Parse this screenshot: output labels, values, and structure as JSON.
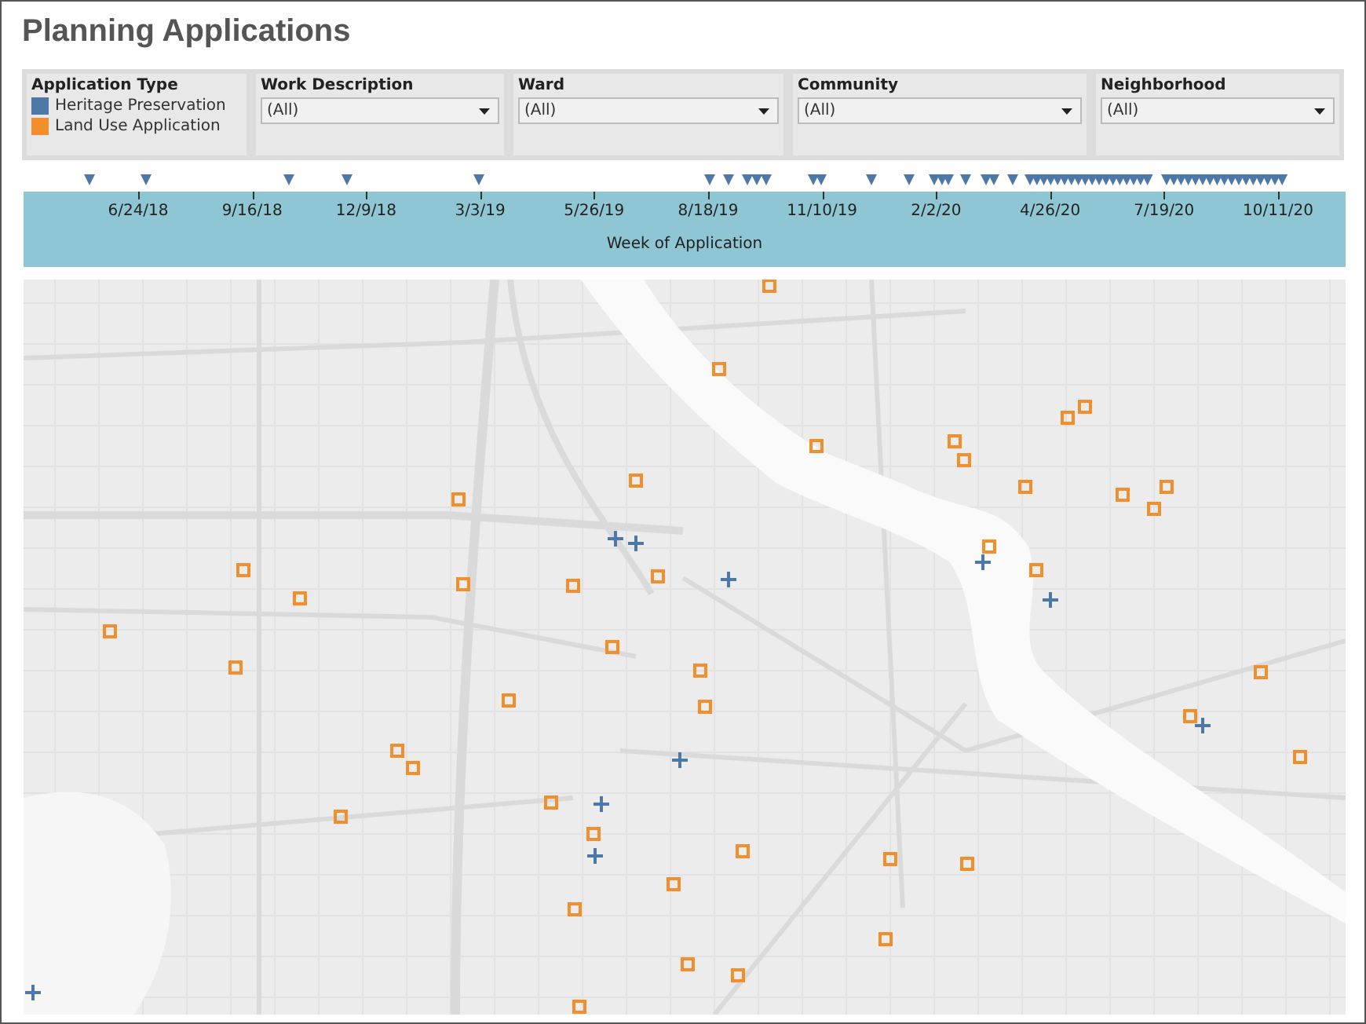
{
  "title": "Planning Applications",
  "legend": {
    "title": "Application Type",
    "items": [
      {
        "label": "Heritage Preservation",
        "color": "#4e79a7"
      },
      {
        "label": "Land Use Application",
        "color": "#f28e2b"
      }
    ]
  },
  "filters": [
    {
      "label": "Work Description",
      "value": "(All)"
    },
    {
      "label": "Ward",
      "value": "(All)"
    },
    {
      "label": "Community",
      "value": "(All)"
    },
    {
      "label": "Neighborhood",
      "value": "(All)"
    }
  ],
  "timeline": {
    "axis_title": "Week of Application",
    "ticks": [
      "6/24/18",
      "9/16/18",
      "12/9/18",
      "3/3/19",
      "5/26/19",
      "8/18/19",
      "11/10/19",
      "2/2/20",
      "4/26/20",
      "7/19/20",
      "10/11/20"
    ]
  }
}
